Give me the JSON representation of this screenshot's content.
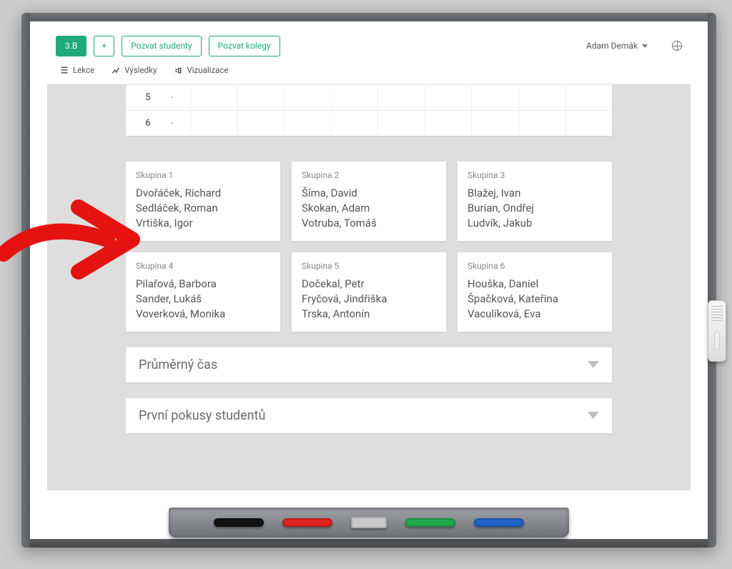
{
  "header": {
    "class_label": "3.B",
    "add_label": "+",
    "invite_students_label": "Pozvat studenty",
    "invite_colleagues_label": "Pozvat kolegy",
    "user_name": "Adam Demák"
  },
  "tabs": {
    "lessons_label": "Lekce",
    "results_label": "Výsledky",
    "visualize_label": "Vizualizace"
  },
  "table_fragment": {
    "rows": [
      {
        "num": "5",
        "value": "-"
      },
      {
        "num": "6",
        "value": "-"
      }
    ]
  },
  "groups": [
    {
      "title": "Skupina 1",
      "members": [
        "Dvořáček, Richard",
        "Sedláček, Roman",
        "Vrtiška, Igor"
      ]
    },
    {
      "title": "Skupina 2",
      "members": [
        "Šíma, David",
        "Skokan, Adam",
        "Votruba, Tomáš"
      ]
    },
    {
      "title": "Skupina 3",
      "members": [
        "Blažej, Ivan",
        "Burian, Ondřej",
        "Ludvík, Jakub"
      ]
    },
    {
      "title": "Skupina 4",
      "members": [
        "Pilařová, Barbora",
        "Sander, Lukáš",
        "Voverková, Monika"
      ]
    },
    {
      "title": "Skupina 5",
      "members": [
        "Dočekal, Petr",
        "Fryčová, Jindřiška",
        "Trska, Antonín"
      ]
    },
    {
      "title": "Skupina 6",
      "members": [
        "Houška, Daniel",
        "Špačková, Kateřina",
        "Vaculíková, Eva"
      ]
    }
  ],
  "panels": {
    "avg_time_label": "Průměrný čas",
    "first_attempts_label": "První pokusy studentů"
  }
}
